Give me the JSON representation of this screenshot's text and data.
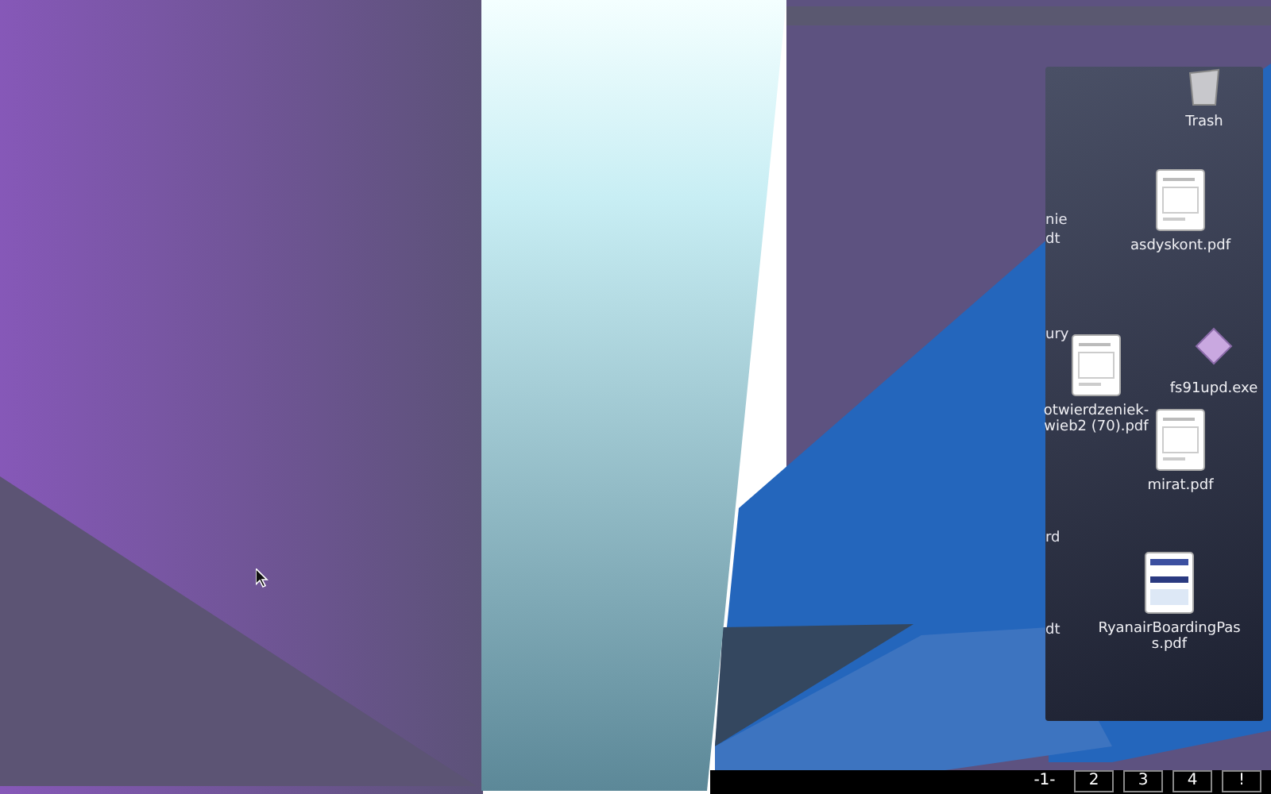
{
  "desktop_icons": [
    {
      "kind": "trash",
      "lines": [
        "Trash"
      ]
    },
    {
      "kind": "document",
      "lines": [
        "asdyskont.pdf"
      ]
    },
    {
      "kind": "document",
      "lines": [
        "otwierdzeniek-",
        "wieb2 (70).pdf"
      ]
    },
    {
      "kind": "program",
      "lines": [
        "fs91upd.exe"
      ]
    },
    {
      "kind": "document",
      "lines": [
        "mirat.pdf"
      ]
    },
    {
      "kind": "boarding",
      "lines": [
        "RyanairBoardingPas",
        "s.pdf"
      ]
    }
  ],
  "edge_labels": [
    "nie",
    "dt",
    "ury",
    "rd",
    "dt"
  ],
  "pager": [
    {
      "label": "-1-",
      "selected": true
    },
    {
      "label": "2",
      "selected": false
    },
    {
      "label": "3",
      "selected": false
    },
    {
      "label": "4",
      "selected": false
    },
    {
      "label": "!",
      "selected": false
    }
  ]
}
